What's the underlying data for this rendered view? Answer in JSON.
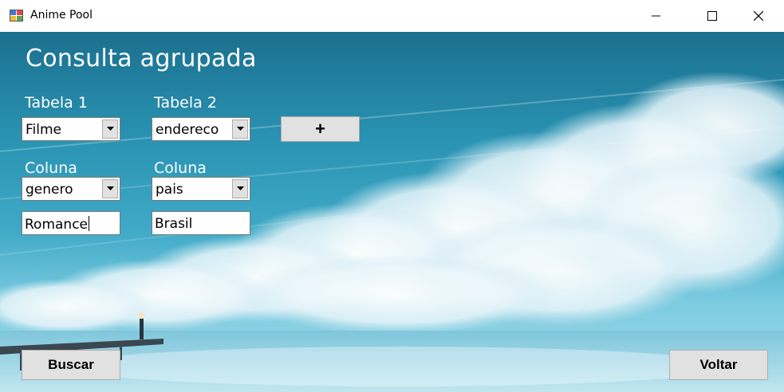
{
  "window": {
    "title": "Anime Pool",
    "icon": "app-window-icon",
    "controls": [
      "minimize-icon",
      "maximize-icon",
      "close-icon"
    ]
  },
  "form": {
    "heading": "Consulta agrupada",
    "table1": {
      "label": "Tabela 1",
      "selected": "Filme"
    },
    "table2": {
      "label": "Tabela 2",
      "selected": "endereco"
    },
    "add_button": "+",
    "column1": {
      "label": "Coluna",
      "selected": "genero",
      "value": "Romance"
    },
    "column2": {
      "label": "Coluna",
      "selected": "pais",
      "value": "Brasil"
    },
    "search_button": "Buscar",
    "back_button": "Voltar"
  },
  "colors": {
    "sky_top": "#1b6f8e",
    "sky_bottom": "#a8dbe8",
    "button_face": "#e1e1e1"
  }
}
